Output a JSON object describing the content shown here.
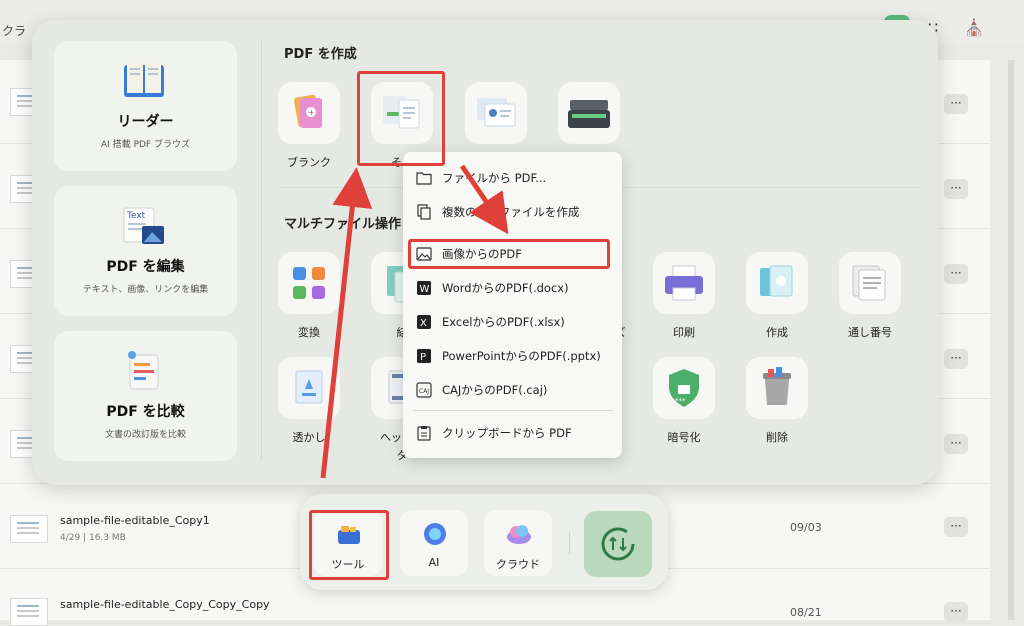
{
  "background": {
    "topbar_label": "クラ",
    "rows": [
      {
        "name": "",
        "meta": "",
        "date": ""
      },
      {
        "name": "",
        "meta": "",
        "date": ""
      },
      {
        "name": "",
        "meta": "",
        "date": ""
      },
      {
        "name": "",
        "meta": "",
        "date": ""
      },
      {
        "name": "",
        "meta": "",
        "date": ""
      },
      {
        "name": "sample-file-editable_Copy1",
        "meta": "4/29 | 16.3 MB",
        "date": "09/03"
      },
      {
        "name": "sample-file-editable_Copy_Copy_Copy",
        "meta": "",
        "date": "08/21"
      }
    ],
    "more_label": "···"
  },
  "features": [
    {
      "title": "リーダー",
      "subtitle": "AI 搭載 PDF ブラウズ",
      "icon": "book-icon"
    },
    {
      "title": "PDF を編集",
      "subtitle": "テキスト、画像、リンクを編集",
      "icon": "text-image-icon",
      "badge": "Text"
    },
    {
      "title": "PDF を比較",
      "subtitle": "文書の改訂版を比較",
      "icon": "compare-icon"
    }
  ],
  "create_section": {
    "title": "PDF を作成",
    "tools": [
      {
        "label": "ブランク",
        "icon": "blank-doc-icon"
      },
      {
        "label": "その",
        "icon": "other-doc-icon"
      },
      {
        "label": "",
        "icon": "id-card-icon"
      },
      {
        "label": "",
        "icon": "scanner-icon"
      }
    ]
  },
  "multi_section": {
    "title": "マルチファイル操作",
    "tools_row1": [
      {
        "label": "変換",
        "icon": "convert-icon"
      },
      {
        "label": "結",
        "icon": "merge-icon"
      },
      {
        "label": "ズ",
        "icon": "optimize-icon"
      },
      {
        "label": "印刷",
        "icon": "printer-icon"
      },
      {
        "label": "作成",
        "icon": "create-icon"
      },
      {
        "label": "通し番号",
        "icon": "bates-number-icon"
      }
    ],
    "tools_row2": [
      {
        "label": "透かし",
        "icon": "watermark-icon"
      },
      {
        "label": "ヘッダー",
        "label2": "タ",
        "icon": "header-footer-icon"
      },
      {
        "label": "暗号化",
        "icon": "encrypt-icon"
      },
      {
        "label": "削除",
        "icon": "trash-icon"
      }
    ]
  },
  "context_menu": {
    "items": [
      {
        "label": "ファイルから PDF...",
        "icon": "folder-icon"
      },
      {
        "label": "複数のPDFファイルを作成",
        "icon": "multi-files-icon"
      },
      {
        "label": "画像からのPDF",
        "icon": "image-icon"
      },
      {
        "label": "WordからのPDF(.docx)",
        "icon": "word-icon"
      },
      {
        "label": "ExcelからのPDF(.xlsx)",
        "icon": "excel-icon"
      },
      {
        "label": "PowerPointからのPDF(.pptx)",
        "icon": "powerpoint-icon"
      },
      {
        "label": "CAJからのPDF(.caj)",
        "icon": "caj-icon"
      },
      {
        "label": "クリップボードから PDF",
        "icon": "clipboard-icon"
      }
    ]
  },
  "dock": {
    "items": [
      {
        "label": "ツール",
        "icon": "toolbox-icon"
      },
      {
        "label": "AI",
        "icon": "ai-icon"
      },
      {
        "label": "クラウド",
        "icon": "cloud-icon"
      }
    ],
    "sync_icon": "sync-icon"
  },
  "colors": {
    "accent_red": "#e0403a",
    "panel_bg": "#e6e9e3",
    "sync_green": "#b9d9bd"
  }
}
